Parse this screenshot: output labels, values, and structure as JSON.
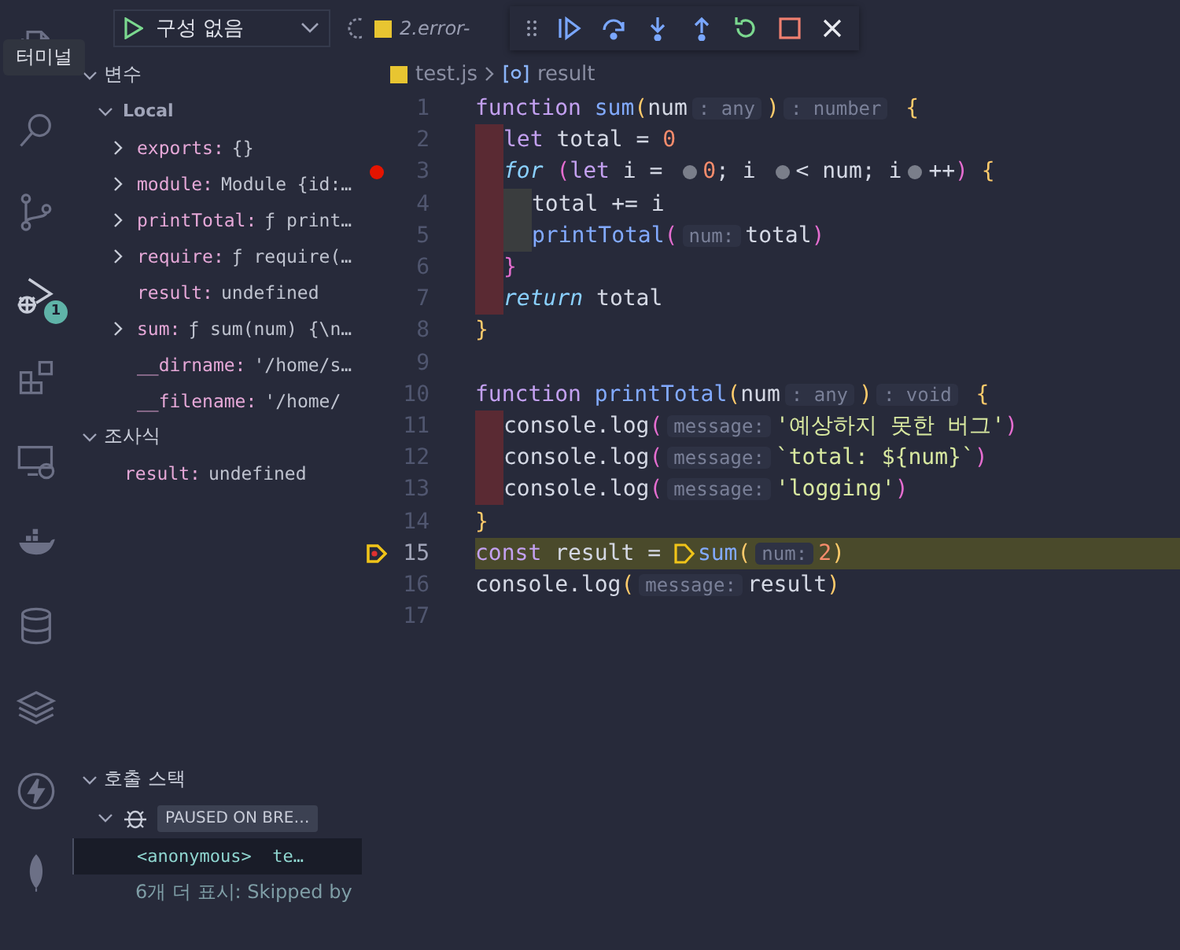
{
  "activity_bar": {
    "tooltip": "터미널",
    "items": [
      {
        "selected": false
      },
      {
        "selected": false
      },
      {
        "selected": false
      },
      {
        "selected": true,
        "badge": "1"
      },
      {
        "selected": false
      },
      {
        "selected": false
      },
      {
        "selected": false
      },
      {
        "selected": false
      },
      {
        "selected": false
      },
      {
        "selected": false
      },
      {
        "selected": false
      }
    ]
  },
  "run_config": {
    "label": "구성 없음"
  },
  "variables": {
    "title": "변수",
    "scope": "Local",
    "items": [
      {
        "kind": "group",
        "name": "exports:",
        "value": "{}"
      },
      {
        "kind": "group",
        "name": "module:",
        "value": "Module {id:…"
      },
      {
        "kind": "group",
        "name": "printTotal:",
        "value": "ƒ print…"
      },
      {
        "kind": "group",
        "name": "require:",
        "value": "ƒ require(…"
      },
      {
        "kind": "leaf",
        "name": "result:",
        "value": "undefined"
      },
      {
        "kind": "group",
        "name": "sum:",
        "value": "ƒ sum(num) {\\n…"
      },
      {
        "kind": "leaf",
        "name": "__dirname:",
        "value": "'/home/s…"
      },
      {
        "kind": "leaf",
        "name": "__filename:",
        "value": "'/home/"
      }
    ]
  },
  "watch": {
    "title": "조사식",
    "items": [
      {
        "name": "result:",
        "value": "undefined"
      }
    ]
  },
  "call_stack": {
    "title": "호출 스택",
    "status": "PAUSED ON BRE…",
    "frames": [
      {
        "name": "<anonymous>",
        "file": "te…",
        "selected": true
      }
    ],
    "more": "6개 더 표시: Skipped by"
  },
  "tab": {
    "label": "2.error-"
  },
  "breadcrumb": {
    "file": "test.js",
    "symbol": "result"
  },
  "code": [
    {
      "n": "1",
      "tokens": [
        {
          "kind": "kw",
          "text": "function "
        },
        {
          "kind": "fn",
          "text": "sum"
        },
        {
          "kind": "brace",
          "text": "("
        },
        {
          "kind": "id",
          "text": "num"
        },
        {
          "kind": "hint",
          "text": ": any"
        },
        {
          "kind": "brace",
          "text": ")"
        },
        {
          "kind": "hint",
          "text": ": number"
        },
        {
          "kind": "brace",
          "text": " {"
        }
      ]
    },
    {
      "n": "2",
      "indent": [
        {
          "kind": "err"
        }
      ],
      "tokens": [
        {
          "kind": "kw",
          "text": "let "
        },
        {
          "kind": "id",
          "text": "total = "
        },
        {
          "kind": "num",
          "text": "0"
        }
      ]
    },
    {
      "n": "3",
      "indent": [
        {
          "kind": "err"
        }
      ],
      "breakpoint": true,
      "tokens": [
        {
          "kind": "ctl",
          "text": "for "
        },
        {
          "kind": "paren",
          "text": "("
        },
        {
          "kind": "kw",
          "text": "let "
        },
        {
          "kind": "id",
          "text": "i = "
        },
        {
          "kind": "dot"
        },
        {
          "kind": "num",
          "text": "0"
        },
        {
          "kind": "id",
          "text": "; i "
        },
        {
          "kind": "dot"
        },
        {
          "kind": "id",
          "text": "< num; i"
        },
        {
          "kind": "dot"
        },
        {
          "kind": "id",
          "text": "++"
        },
        {
          "kind": "paren",
          "text": ")"
        },
        {
          "kind": "brace",
          "text": " {"
        }
      ]
    },
    {
      "n": "4",
      "indent": [
        {
          "kind": "err"
        },
        {
          "kind": "plain"
        }
      ],
      "tokens": [
        {
          "kind": "id",
          "text": "total += i"
        }
      ]
    },
    {
      "n": "5",
      "indent": [
        {
          "kind": "err"
        },
        {
          "kind": "plain"
        }
      ],
      "tokens": [
        {
          "kind": "fn",
          "text": "printTotal"
        },
        {
          "kind": "paren",
          "text": "("
        },
        {
          "kind": "hint",
          "text": "num:"
        },
        {
          "kind": "id",
          "text": "total"
        },
        {
          "kind": "paren",
          "text": ")"
        }
      ]
    },
    {
      "n": "6",
      "indent": [
        {
          "kind": "err"
        }
      ],
      "tokens": [
        {
          "kind": "paren",
          "text": "}"
        }
      ]
    },
    {
      "n": "7",
      "indent": [
        {
          "kind": "err"
        }
      ],
      "tokens": [
        {
          "kind": "ctl",
          "text": "return "
        },
        {
          "kind": "id",
          "text": "total"
        }
      ]
    },
    {
      "n": "8",
      "tokens": [
        {
          "kind": "brace",
          "text": "}"
        }
      ]
    },
    {
      "n": "9"
    },
    {
      "n": "10",
      "tokens": [
        {
          "kind": "kw",
          "text": "function "
        },
        {
          "kind": "fn",
          "text": "printTotal"
        },
        {
          "kind": "brace",
          "text": "("
        },
        {
          "kind": "id",
          "text": "num"
        },
        {
          "kind": "hint",
          "text": ": any"
        },
        {
          "kind": "brace",
          "text": ")"
        },
        {
          "kind": "hint",
          "text": ": void"
        },
        {
          "kind": "brace",
          "text": " {"
        }
      ]
    },
    {
      "n": "11",
      "indent": [
        {
          "kind": "err"
        }
      ],
      "tokens": [
        {
          "kind": "id",
          "text": "console.log"
        },
        {
          "kind": "paren",
          "text": "("
        },
        {
          "kind": "hint",
          "text": "message:"
        },
        {
          "kind": "str",
          "text": "'예상하지 못한 버그'"
        },
        {
          "kind": "paren",
          "text": ")"
        }
      ]
    },
    {
      "n": "12",
      "indent": [
        {
          "kind": "err"
        }
      ],
      "tokens": [
        {
          "kind": "id",
          "text": "console.log"
        },
        {
          "kind": "paren",
          "text": "("
        },
        {
          "kind": "hint",
          "text": "message:"
        },
        {
          "kind": "str",
          "text": "`total: ${num}`"
        },
        {
          "kind": "paren",
          "text": ")"
        }
      ]
    },
    {
      "n": "13",
      "indent": [
        {
          "kind": "err"
        }
      ],
      "tokens": [
        {
          "kind": "id",
          "text": "console.log"
        },
        {
          "kind": "paren",
          "text": "("
        },
        {
          "kind": "hint",
          "text": "message:"
        },
        {
          "kind": "str",
          "text": "'logging'"
        },
        {
          "kind": "paren",
          "text": ")"
        }
      ]
    },
    {
      "n": "14",
      "tokens": [
        {
          "kind": "brace",
          "text": "}"
        }
      ]
    },
    {
      "n": "15",
      "current": true,
      "tokens": [
        {
          "kind": "kw",
          "text": "const "
        },
        {
          "kind": "id",
          "text": "result = "
        },
        {
          "kind": "stop"
        },
        {
          "kind": "fn",
          "text": "sum"
        },
        {
          "kind": "brace",
          "text": "("
        },
        {
          "kind": "hint",
          "text": "num:"
        },
        {
          "kind": "num",
          "text": "2"
        },
        {
          "kind": "brace",
          "text": ")"
        }
      ]
    },
    {
      "n": "16",
      "tokens": [
        {
          "kind": "id",
          "text": "console.log"
        },
        {
          "kind": "brace",
          "text": "("
        },
        {
          "kind": "hint",
          "text": "message:"
        },
        {
          "kind": "id",
          "text": "result"
        },
        {
          "kind": "brace",
          "text": ")"
        }
      ]
    },
    {
      "n": "17"
    }
  ]
}
